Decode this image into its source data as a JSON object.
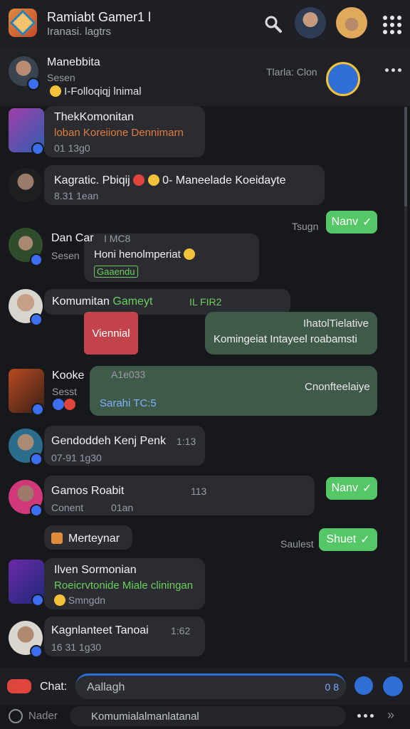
{
  "header": {
    "title": "Ramiabt Gamer1 l",
    "subtitle": "Iranasi. lagtrs"
  },
  "pinned": {
    "name": "Manebbita",
    "preview": "Sesen",
    "message": "I-Folloqiqj lnimal",
    "side_label": "Tlarla: Clon"
  },
  "messages": [
    {
      "name": "ThekKomonitan",
      "line": "loban Koreiione Dennimarn",
      "meta": "01 13g0",
      "color": "#e07c3b"
    },
    {
      "name": "Kagratic. Pbiqij",
      "line": "0- Maneelade Koeidayte",
      "meta": "8.31 1ean"
    },
    {
      "name": "Dan Car",
      "meta_top": "I MC8",
      "line": "Honi henolmperiat",
      "meta": "Sesen",
      "tag": "Gaaendu"
    },
    {
      "name": "Komumitan",
      "highlight": "Gameyt",
      "meta_top": "IL FIR2"
    },
    {
      "name": "Kooke",
      "meta_top": "A1e033",
      "meta": "Sesst",
      "line": "Sarahi TC:5"
    },
    {
      "name": "Gendoddeh Kenj Penk",
      "meta_top": "1:13",
      "meta": "07-91 1g30"
    },
    {
      "name": "Gamos Roabit",
      "meta_top": "113",
      "meta": "Conent",
      "meta2": "01an"
    },
    {
      "name": "Merteynar"
    },
    {
      "name": "Ilven Sormonian",
      "line": "Roeicrvtonide Miale cliningan",
      "meta": "Smngdn",
      "color": "#6ccf5a"
    },
    {
      "name": "Kagnlanteet Tanoai",
      "meta_top": "1:62",
      "meta": "16 31 1g30"
    }
  ],
  "outgoing": [
    {
      "label": "Nanv",
      "time": "Tsugn"
    },
    {
      "label": "Nanv"
    },
    {
      "label": "Shuet",
      "time": "Saulest"
    }
  ],
  "cards": {
    "red": "Viennial",
    "green_title": "IhatolTielative",
    "green_text": "Komingeiat Intayeel roabamsti",
    "wide_title": "Cnonfteelaiye"
  },
  "composer": {
    "label": "Chat:",
    "placeholder": "Aallagh",
    "count": "0 8"
  },
  "footer": {
    "left": "Nader",
    "field": "Komumialalmanlatanal"
  },
  "colors": {
    "accent": "#55c766",
    "brand_blue": "#3c6ff0",
    "bg": "#17181c"
  }
}
